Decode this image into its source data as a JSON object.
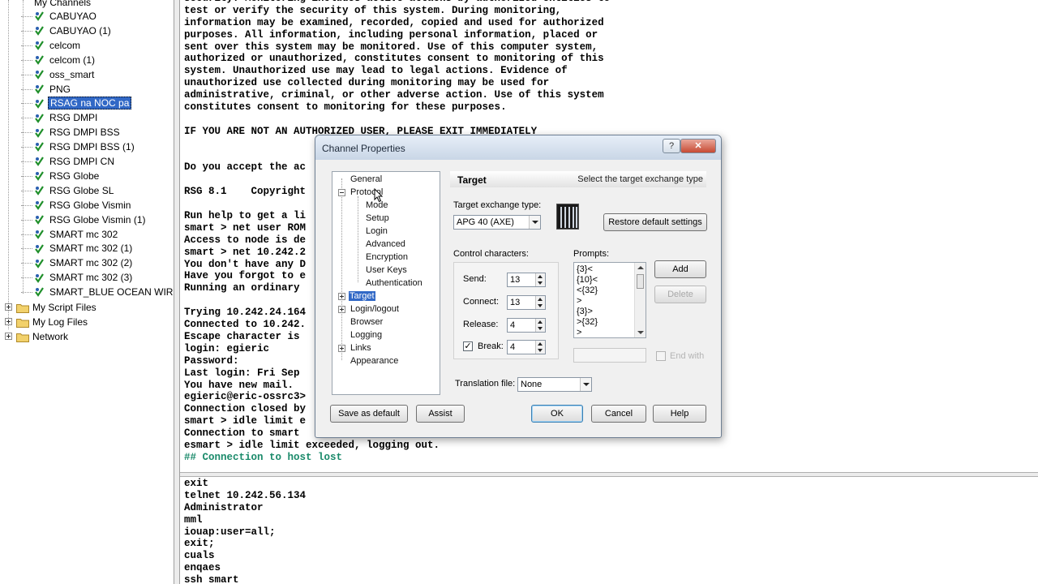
{
  "tree": {
    "items": [
      {
        "label": "My Channels"
      },
      {
        "label": "CABUYAO"
      },
      {
        "label": "CABUYAO (1)"
      },
      {
        "label": "celcom"
      },
      {
        "label": "celcom (1)"
      },
      {
        "label": "oss_smart"
      },
      {
        "label": "PNG"
      },
      {
        "label": "RSAG na NOC pa",
        "selected": true
      },
      {
        "label": "RSG DMPI"
      },
      {
        "label": "RSG DMPI BSS"
      },
      {
        "label": "RSG DMPI BSS (1)"
      },
      {
        "label": "RSG DMPI CN"
      },
      {
        "label": "RSG Globe"
      },
      {
        "label": "RSG Globe SL"
      },
      {
        "label": "RSG Globe Vismin"
      },
      {
        "label": "RSG Globe Vismin (1)"
      },
      {
        "label": "SMART mc 302"
      },
      {
        "label": "SMART mc 302 (1)"
      },
      {
        "label": "SMART mc 302 (2)"
      },
      {
        "label": "SMART mc 302 (3)"
      },
      {
        "label": "SMART_BLUE OCEAN WIRELESS"
      }
    ],
    "folders": [
      {
        "label": "My Script Files"
      },
      {
        "label": "My Log Files"
      },
      {
        "label": "Network"
      }
    ],
    "icon": "channel-icon",
    "folder_icon": "folder-icon"
  },
  "terminal": {
    "lines": [
      "security. Monitoring includes active attacks by authorized entities to",
      "test or verify the security of this system. During monitoring,",
      "information may be examined, recorded, copied and used for authorized",
      "purposes. All information, including personal information, placed or",
      "sent over this system may be monitored. Use of this computer system,",
      "authorized or unauthorized, constitutes consent to monitoring of this",
      "system. Unauthorized use may lead to legal actions. Evidence of",
      "unauthorized use collected during monitoring may be used for",
      "administrative, criminal, or other adverse action. Use of this system",
      "constitutes consent to monitoring for these purposes.",
      "",
      "IF YOU ARE NOT AN AUTHORIZED USER, PLEASE EXIT IMMEDIATELY",
      "",
      "",
      "Do you accept the ac",
      "",
      "RSG 8.1    Copyright",
      "",
      "Run help to get a li",
      "smart > net user ROM",
      "Access to node is de",
      "smart > net 10.242.2",
      "You don't have any D",
      "Have you forgot to e",
      "Running an ordinary ",
      "",
      "Trying 10.242.24.164",
      "Connected to 10.242.",
      "Escape character is ",
      "login: egieric",
      "Password:",
      "Last login: Fri Sep ",
      "You have new mail.",
      "egieric@eric-ossrc3>",
      "Connection closed by",
      "smart > idle limit e",
      "Connection to smart ",
      "esmart > idle limit exceeded, logging out.",
      "## Connection to host lost"
    ],
    "status_color": "#1a8a6a"
  },
  "history": {
    "lines": [
      "exit",
      "telnet 10.242.56.134",
      "Administrator",
      "mml",
      "iouap:user=all;",
      "exit;",
      "cuals",
      "enqaes",
      "ssh smart"
    ]
  },
  "dialog": {
    "title": "Channel Properties",
    "help_glyph": "?",
    "close_glyph": "✕",
    "nav": {
      "general": "General",
      "protocol": "Protocol",
      "mode": "Mode",
      "setup": "Setup",
      "login": "Login",
      "advanced": "Advanced",
      "encryption": "Encryption",
      "user_keys": "User Keys",
      "authentication": "Authentication",
      "target": "Target",
      "login_logout": "Login/logout",
      "browser": "Browser",
      "logging": "Logging",
      "links": "Links",
      "appearance": "Appearance"
    },
    "section": {
      "title": "Target",
      "description": "Select the target exchange type"
    },
    "exchange_label": "Target exchange type:",
    "exchange_value": "APG 40 (AXE)",
    "restore_defaults": "Restore default settings",
    "control_chars_label": "Control characters:",
    "send_label": "Send:",
    "send_value": "13",
    "connect_label": "Connect:",
    "connect_value": "13",
    "release_label": "Release:",
    "release_value": "4",
    "break_label": "Break:",
    "break_value": "4",
    "break_checked": "✓",
    "prompts_label": "Prompts:",
    "prompts": [
      "{3}<",
      "{10}<",
      "<{32}",
      ">",
      "{3}>",
      ">{32}",
      ">"
    ],
    "add_button": "Add",
    "delete_button": "Delete",
    "end_label": "End with",
    "translation_label": "Translation file:",
    "translation_value": "None",
    "save_default_button": "Save as default",
    "assist_button": "Assist",
    "ok_button": "OK",
    "cancel_button": "Cancel",
    "help_button": "Help"
  }
}
